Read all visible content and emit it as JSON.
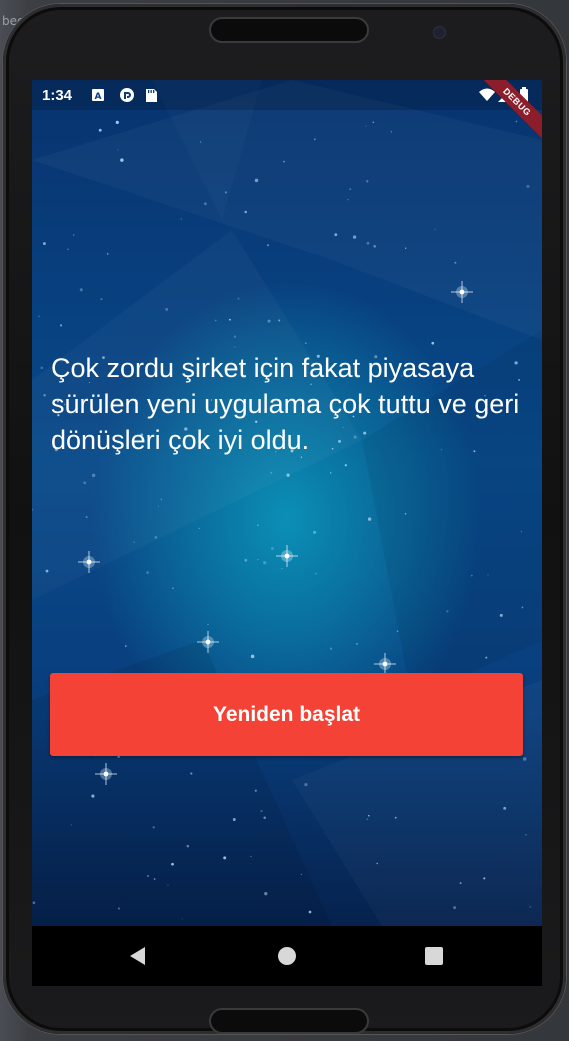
{
  "desktop": {
    "fragment_text": "bec.ya"
  },
  "status_bar": {
    "time": "1:34",
    "left_icons": [
      "a-box-icon",
      "cast-icon",
      "sd-card-icon"
    ],
    "right_icons": [
      "wifi-icon",
      "cell-signal-icon",
      "battery-icon"
    ]
  },
  "debug_banner": {
    "label": "DEBUG"
  },
  "app": {
    "message": "Çok zordu şirket için fakat piyasaya sürülen yeni uygulama çok tuttu ve geri dönüşleri çok iyi oldu.",
    "restart_button_label": "Yeniden başlat"
  },
  "nav_bar": {
    "buttons": [
      "back-icon",
      "home-icon",
      "recents-icon"
    ]
  },
  "colors": {
    "button": "#f44336",
    "background_top": "#07336f",
    "background_center": "#0b8fb6",
    "banner": "#8b1e2a"
  }
}
